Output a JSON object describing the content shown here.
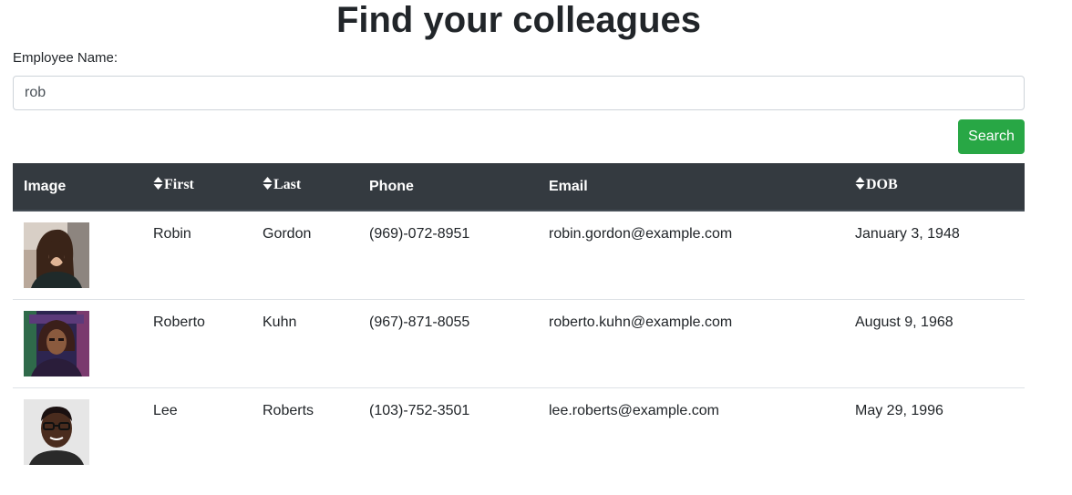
{
  "page": {
    "title": "Find your colleagues"
  },
  "search": {
    "label": "Employee Name:",
    "value": "rob",
    "button_label": "Search"
  },
  "table": {
    "headers": {
      "image": "Image",
      "first": "First",
      "last": "Last",
      "phone": "Phone",
      "email": "Email",
      "dob": "DOB"
    },
    "sortable_icon": "sort-both-icon",
    "rows": [
      {
        "first": "Robin",
        "last": "Gordon",
        "phone": "(969)-072-8951",
        "email": "robin.gordon@example.com",
        "dob": "January 3, 1948",
        "photo_icon": "woman-long-hair-portrait"
      },
      {
        "first": "Roberto",
        "last": "Kuhn",
        "phone": "(967)-871-8055",
        "email": "roberto.kuhn@example.com",
        "dob": "August 9, 1968",
        "photo_icon": "man-colorful-backdrop-portrait"
      },
      {
        "first": "Lee",
        "last": "Roberts",
        "phone": "(103)-752-3501",
        "email": "lee.roberts@example.com",
        "dob": "May 29, 1996",
        "photo_icon": "man-glasses-portrait"
      }
    ]
  },
  "colors": {
    "header_bg": "#343a40",
    "button_bg": "#28a745",
    "text": "#212529",
    "border": "#dee2e6"
  }
}
